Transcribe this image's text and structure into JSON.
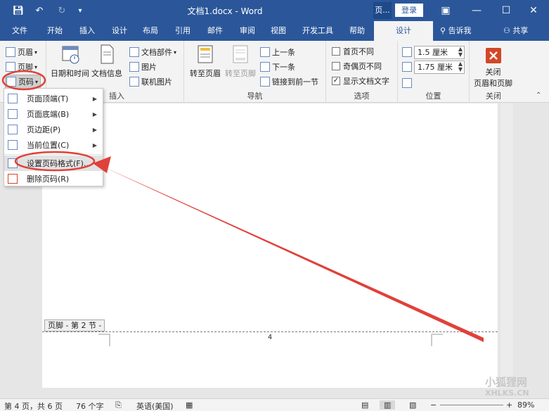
{
  "window": {
    "title": "文档1.docx - Word",
    "context_label": "页...",
    "login_label": "登录"
  },
  "tabs": [
    {
      "label": "文件"
    },
    {
      "label": "开始"
    },
    {
      "label": "插入"
    },
    {
      "label": "设计"
    },
    {
      "label": "布局"
    },
    {
      "label": "引用"
    },
    {
      "label": "邮件"
    },
    {
      "label": "审阅"
    },
    {
      "label": "视图"
    },
    {
      "label": "开发工具"
    },
    {
      "label": "帮助"
    },
    {
      "label": "设计"
    }
  ],
  "tellme": "告诉我",
  "share": "共享",
  "ribbon": {
    "header_btn": "页眉",
    "footer_btn": "页脚",
    "pagenum_btn": "页码",
    "datetime_btn": "日期和时间",
    "docinfo_btn": "文档信息",
    "docparts_btn": "文档部件",
    "picture_btn": "图片",
    "online_picture_btn": "联机图片",
    "insert_group": "插入",
    "goto_header_btn": "转至页眉",
    "goto_footer_btn": "转至页脚",
    "prev_btn": "上一条",
    "next_btn": "下一条",
    "link_prev_btn": "链接到前一节",
    "nav_group": "导航",
    "first_page_diff": "首页不同",
    "odd_even_diff": "奇偶页不同",
    "show_doc_text": "显示文档文字",
    "options_group": "选项",
    "header_pos": "1.5 厘米",
    "footer_pos": "1.75 厘米",
    "position_group": "位置",
    "close_btn_line1": "关闭",
    "close_btn_line2": "页眉和页脚",
    "close_group": "关闭"
  },
  "menu": {
    "items": [
      {
        "label": "页面顶端(T)"
      },
      {
        "label": "页面底端(B)"
      },
      {
        "label": "页边距(P)"
      },
      {
        "label": "当前位置(C)"
      },
      {
        "label": "设置页码格式(F)..."
      },
      {
        "label": "删除页码(R)"
      }
    ]
  },
  "document": {
    "footer_tag": "页脚 - 第 2 节 -",
    "page_number_text": "4"
  },
  "status": {
    "page": "第 4 页，共 6 页",
    "words": "76 个字",
    "language": "英语(美国)",
    "zoom": "89%"
  },
  "watermark": {
    "line1": "小狐狸网",
    "line2": "XHLKS.CN"
  },
  "colors": {
    "accent": "#2b579a",
    "annotation": "#e0413a"
  }
}
